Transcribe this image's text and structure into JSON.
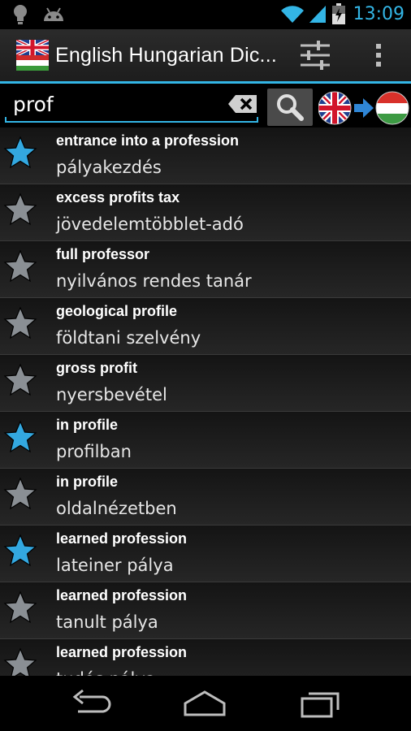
{
  "status_bar": {
    "time": "13:09",
    "left_icons": [
      "lightbulb-icon",
      "android-icon"
    ],
    "right_icons": [
      "wifi-icon",
      "signal-icon",
      "battery-charging-icon"
    ]
  },
  "action_bar": {
    "title": "English Hungarian Dic...",
    "flag": "uk-flag-icon",
    "settings_icon": "sliders-icon",
    "overflow_icon": "overflow-menu-icon"
  },
  "search": {
    "value": "prof",
    "clear_icon": "backspace-icon",
    "search_icon": "search-icon",
    "direction": {
      "from": "uk-flag-icon",
      "arrow": "arrow-right-icon",
      "to": "hungary-flag-icon"
    }
  },
  "colors": {
    "accent": "#33b5e5",
    "star_favorite": "#33a8e0",
    "star_normal": "#8a8f94"
  },
  "results": [
    {
      "en": "entrance into a profession",
      "hu": "pályakezdés",
      "favorite": true
    },
    {
      "en": "excess profits tax",
      "hu": "jövedelemtöbblet-adó",
      "favorite": false
    },
    {
      "en": "full professor",
      "hu": "nyilvános rendes tanár",
      "favorite": false
    },
    {
      "en": "geological profile",
      "hu": "földtani szelvény",
      "favorite": false
    },
    {
      "en": "gross profit",
      "hu": "nyersbevétel",
      "favorite": false
    },
    {
      "en": "in profile",
      "hu": "profilban",
      "favorite": true
    },
    {
      "en": "in profile",
      "hu": "oldalnézetben",
      "favorite": false
    },
    {
      "en": "learned profession",
      "hu": "lateiner pálya",
      "favorite": true
    },
    {
      "en": "learned profession",
      "hu": "tanult pálya",
      "favorite": false
    },
    {
      "en": "learned profession",
      "hu": "tudós pálya",
      "favorite": false
    }
  ],
  "nav_bar": {
    "back": "back-icon",
    "home": "home-icon",
    "recents": "recents-icon"
  }
}
